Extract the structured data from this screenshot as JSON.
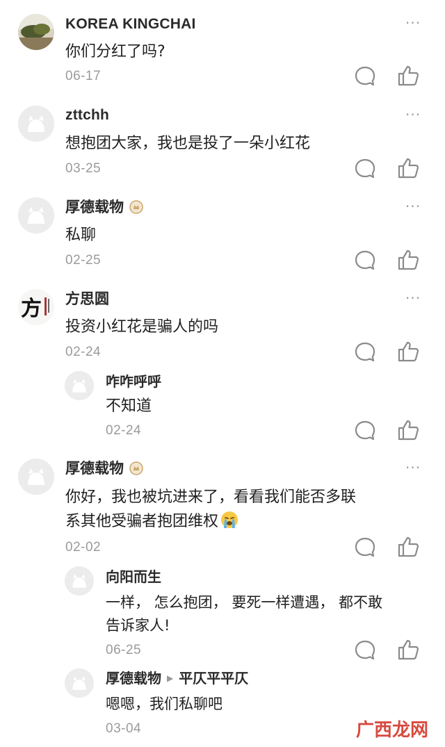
{
  "comments": [
    {
      "user": "KOREA KINGCHAI",
      "text": "你们分红了吗?",
      "date": "06-17",
      "avatar_icon": "landscape-avatar-icon"
    },
    {
      "user": "zttchh",
      "text": "想抱团大家，我也是投了一朵小红花",
      "date": "03-25",
      "avatar_icon": "default-avatar-icon"
    },
    {
      "user": "厚德载物",
      "text": "私聊",
      "date": "02-25",
      "avatar_icon": "default-avatar-icon",
      "badge_icon": "level-badge-icon"
    },
    {
      "user": "方思圆",
      "text": "投资小红花是骗人的吗",
      "date": "02-24",
      "avatar_icon": "calligraphy-avatar-icon",
      "avatar_char": "方"
    },
    {
      "user": "咋咋呼呼",
      "text": "不知道",
      "date": "02-24",
      "avatar_icon": "default-avatar-icon",
      "is_reply": true
    },
    {
      "user": "厚德载物",
      "text_line1": "你好，我也被坑进来了，看看我们能否多联",
      "text_line2": "系其他受骗者抱团维权",
      "date": "02-02",
      "avatar_icon": "default-avatar-icon",
      "badge_icon": "level-badge-icon",
      "emoji_icon": "crying-emoji-icon"
    },
    {
      "user": "向阳而生",
      "text_line1": "一样， 怎么抱团， 要死一样遭遇， 都不敢",
      "text_line2": "告诉家人!",
      "date": "06-25",
      "avatar_icon": "default-avatar-icon",
      "is_reply": true
    },
    {
      "user": "厚德载物",
      "reply_to": "平仄平平仄",
      "text": "嗯嗯，我们私聊吧",
      "date": "03-04",
      "avatar_icon": "default-avatar-icon",
      "is_reply": true
    }
  ],
  "actions": {
    "more_label": "···",
    "comment_icon": "comment-bubble-icon",
    "like_icon": "thumbs-up-icon"
  },
  "watermark": "广西龙网",
  "colors": {
    "date": "#9a9a9a",
    "icon": "#8a8a8a",
    "badge": "#c9a66b",
    "watermark": "#d43b2f"
  }
}
